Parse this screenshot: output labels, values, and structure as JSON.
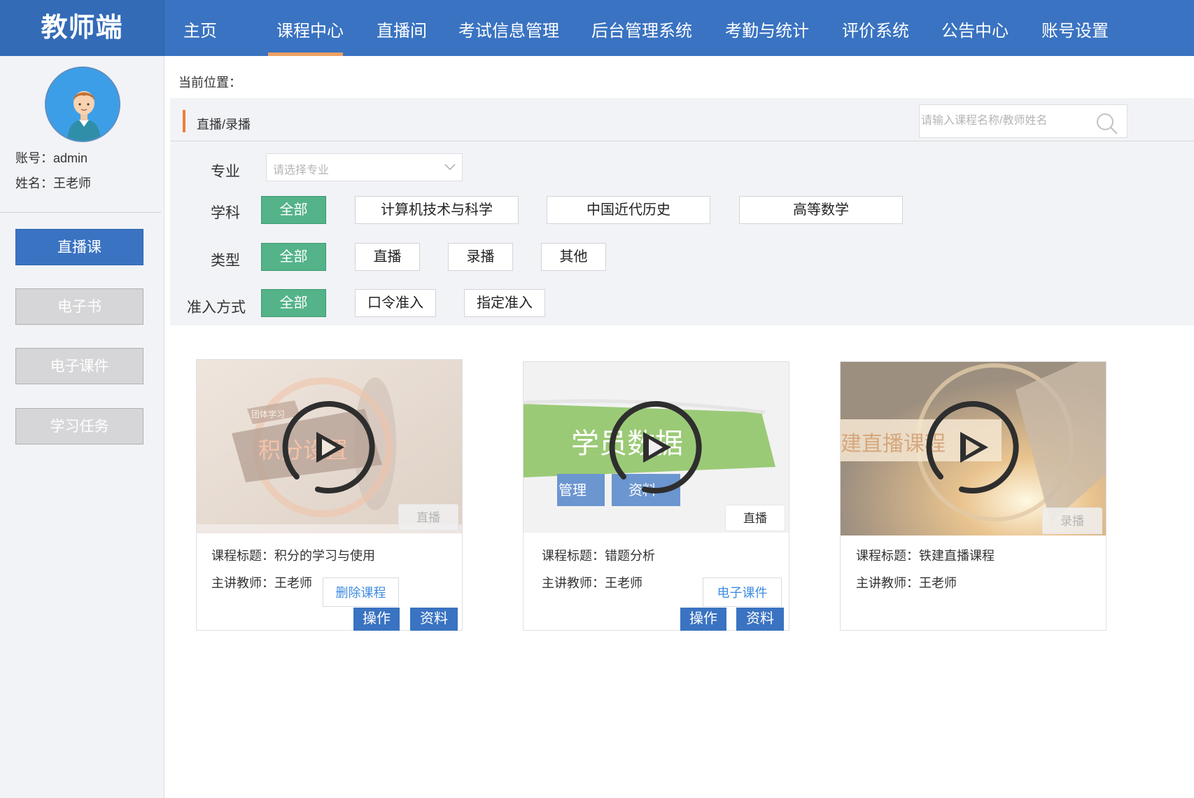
{
  "app": {
    "brand": "教师端"
  },
  "nav": {
    "items": [
      "主页",
      "课程中心",
      "直播间",
      "考试信息管理",
      "后台管理系统",
      "考勤与统计",
      "评价系统",
      "公告中心",
      "账号设置"
    ],
    "active": "课程中心",
    "accent": "#f0a061"
  },
  "user": {
    "account_label": "账号：",
    "account": "admin",
    "name_label": "姓名：",
    "name": "王老师"
  },
  "sidebar": {
    "items": [
      "直播课",
      "电子书",
      "电子课件",
      "学习任务"
    ],
    "active": "直播课"
  },
  "breadcrumb": {
    "label": "当前位置："
  },
  "section": {
    "title": "直播/录播",
    "search_placeholder": "请输入课程名称/教师姓名"
  },
  "filters": {
    "major": {
      "label": "专业",
      "placeholder": "请选择专业"
    },
    "subject": {
      "label": "学科",
      "options": [
        "全部",
        "计算机技术与科学",
        "中国近代历史",
        "高等数学"
      ],
      "selected": "全部"
    },
    "type": {
      "label": "类型",
      "options": [
        "全部",
        "直播",
        "录播",
        "其他"
      ],
      "selected": "全部"
    },
    "access": {
      "label": "准入方式",
      "options": [
        "全部",
        "口令准入",
        "指定准入"
      ],
      "selected": "全部"
    }
  },
  "courses": [
    {
      "thumb_text": "积分设置",
      "thumb_badge": "团体学习",
      "type_tag": "直播",
      "title_label": "课程标题：",
      "title": "积分的学习与使用",
      "teacher_label": "主讲教师：",
      "teacher": "王老师",
      "ghost_button": "删除课程",
      "buttons": [
        "操作",
        "资料"
      ]
    },
    {
      "thumb_text": "学员数据",
      "thumb_sub": [
        "管理",
        "资料"
      ],
      "type_tag": "直播",
      "title_label": "课程标题：",
      "title": "错题分析",
      "teacher_label": "主讲教师：",
      "teacher": "王老师",
      "ghost_button": "电子课件",
      "buttons": [
        "操作",
        "资料"
      ]
    },
    {
      "thumb_text": "建直播课程",
      "type_tag": "录播",
      "title_label": "课程标题：",
      "title": "铁建直播课程",
      "teacher_label": "主讲教师：",
      "teacher": "王老师"
    }
  ],
  "colors": {
    "primary": "#3a73c1",
    "selected_chip": "#54b389",
    "section_mark": "#f07c3c",
    "link": "#3d8de0"
  }
}
